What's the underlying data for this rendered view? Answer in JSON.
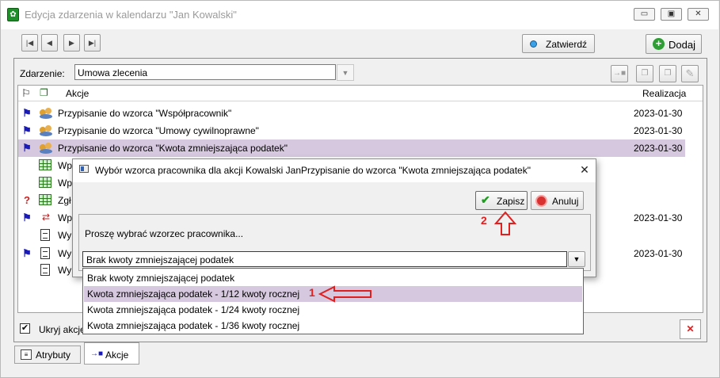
{
  "window": {
    "title": "Edycja zdarzenia w kalendarzu \"Jan Kowalski\"",
    "minimize_glyph": "▭",
    "maximize_glyph": "▣",
    "close_glyph": "✕"
  },
  "toolbar": {
    "nav_first": "|◀",
    "nav_prev": "◀",
    "nav_next": "▶",
    "nav_last": "▶|",
    "confirm_label": "Zatwierdź",
    "add_label": "Dodaj"
  },
  "event": {
    "label": "Zdarzenie:",
    "value": "Umowa zlecenia"
  },
  "table": {
    "col_actions": "Akcje",
    "col_realization": "Realizacja",
    "rows": [
      {
        "text": "Przypisanie do wzorca \"Współpracownik\"",
        "date": "2023-01-30"
      },
      {
        "text": "Przypisanie do wzorca \"Umowy cywilnoprawne\"",
        "date": "2023-01-30"
      },
      {
        "text": "Przypisanie do wzorca \"Kwota zmniejszająca podatek\"",
        "date": "2023-01-30"
      },
      {
        "text": "Wp",
        "date": ""
      },
      {
        "text": "Wp",
        "date": ""
      },
      {
        "text": "Zgł",
        "date": ""
      },
      {
        "text": "Wp",
        "date": "2023-01-30"
      },
      {
        "text": "Wy",
        "date": ""
      },
      {
        "text": "Wy",
        "date": "2023-01-30"
      },
      {
        "text": "Wy",
        "date": ""
      }
    ]
  },
  "footer": {
    "hide_label": "Ukryj akcje",
    "delete_glyph": "✕"
  },
  "tabs": [
    {
      "label": "Atrybuty"
    },
    {
      "label": "Akcje"
    }
  ],
  "dialog": {
    "title": "Wybór wzorca pracownika dla akcji  Kowalski JanPrzypisanie do wzorca \"Kwota zmniejszająca podatek\"",
    "close_glyph": "✕",
    "save_label": "Zapisz",
    "cancel_label": "Anuluj",
    "prompt": "Proszę wybrać wzorzec pracownika...",
    "selected": "Brak kwoty zmniejszającej podatek",
    "options": [
      "Brak kwoty zmniejszającej podatek",
      "Kwota zmniejszająca podatek - 1/12 kwoty rocznej",
      "Kwota zmniejszająca podatek - 1/24 kwoty rocznej",
      "Kwota zmniejszająca podatek - 1/36 kwoty rocznej"
    ]
  },
  "annotations": {
    "step1": "1",
    "step2": "2"
  },
  "colors": {
    "selection": "#d6c8de",
    "annotation_red": "#e02020"
  }
}
